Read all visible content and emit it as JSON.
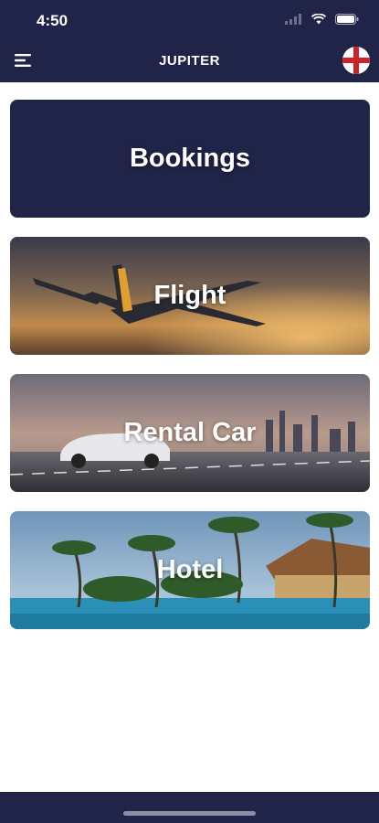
{
  "status": {
    "time": "4:50"
  },
  "header": {
    "title": "JUPITER",
    "menu_icon": "hamburger-menu-icon",
    "flag_icon": "england-flag-icon"
  },
  "cards": [
    {
      "label": "Bookings"
    },
    {
      "label": "Flight"
    },
    {
      "label": "Rental Car"
    },
    {
      "label": "Hotel"
    }
  ],
  "colors": {
    "primary": "#1f2448",
    "background": "#ffffff",
    "flag_red": "#d0202a"
  }
}
